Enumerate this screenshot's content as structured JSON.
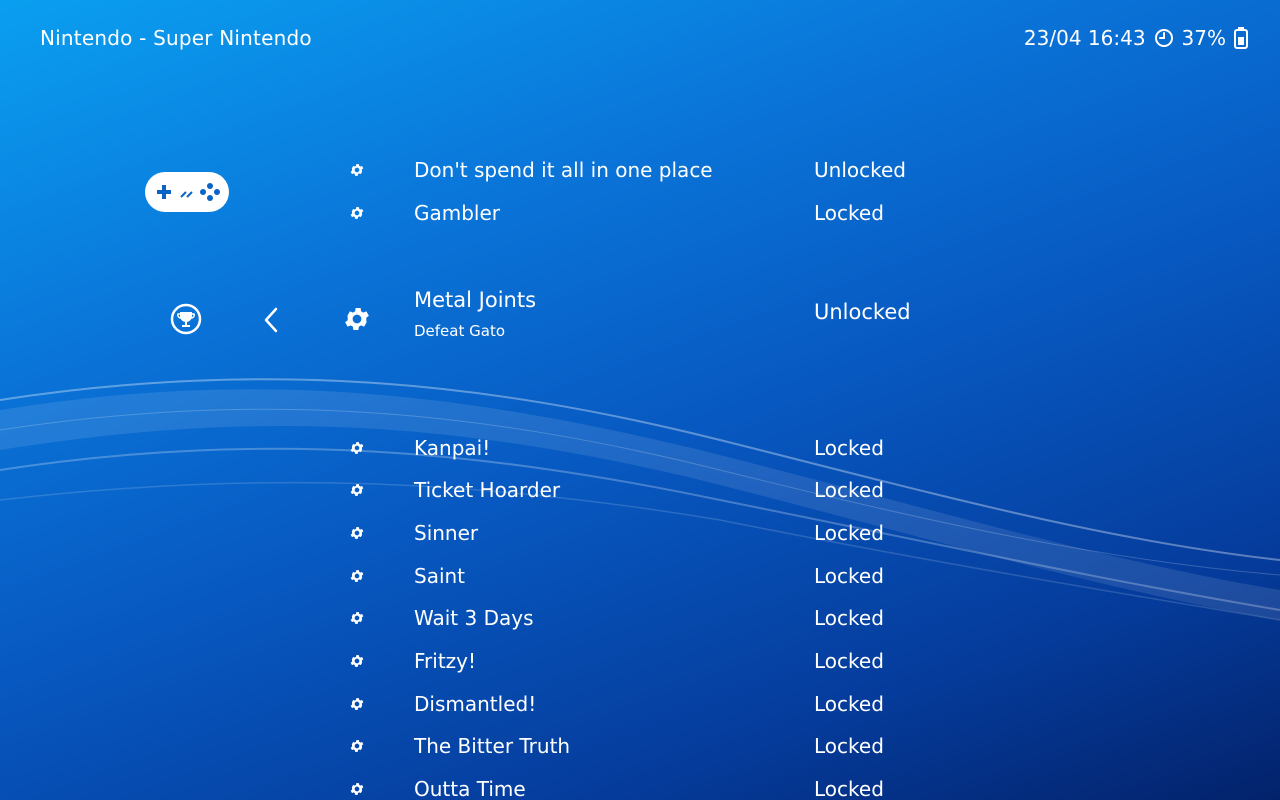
{
  "header": {
    "title": "Nintendo - Super Nintendo",
    "datetime": "23/04 16:43",
    "battery": "37%",
    "clock_icon": "clock-icon",
    "battery_icon": "battery-icon"
  },
  "sidebar": {
    "controller_icon": "snes-controller-icon",
    "trophy_icon": "trophy-icon",
    "back_icon": "chevron-left-icon"
  },
  "achievements": [
    {
      "name": "Don't spend it all in one place",
      "status": "Unlocked"
    },
    {
      "name": "Gambler",
      "status": "Locked"
    },
    {
      "name": "Metal Joints",
      "description": "Defeat Gato",
      "status": "Unlocked",
      "selected": true
    },
    {
      "name": "Kanpai!",
      "status": "Locked"
    },
    {
      "name": "Ticket Hoarder",
      "status": "Locked"
    },
    {
      "name": "Sinner",
      "status": "Locked"
    },
    {
      "name": "Saint",
      "status": "Locked"
    },
    {
      "name": "Wait 3 Days",
      "status": "Locked"
    },
    {
      "name": "Fritzy!",
      "status": "Locked"
    },
    {
      "name": "Dismantled!",
      "status": "Locked"
    },
    {
      "name": "The Bitter Truth",
      "status": "Locked"
    },
    {
      "name": "Outta Time",
      "status": "Locked"
    }
  ]
}
